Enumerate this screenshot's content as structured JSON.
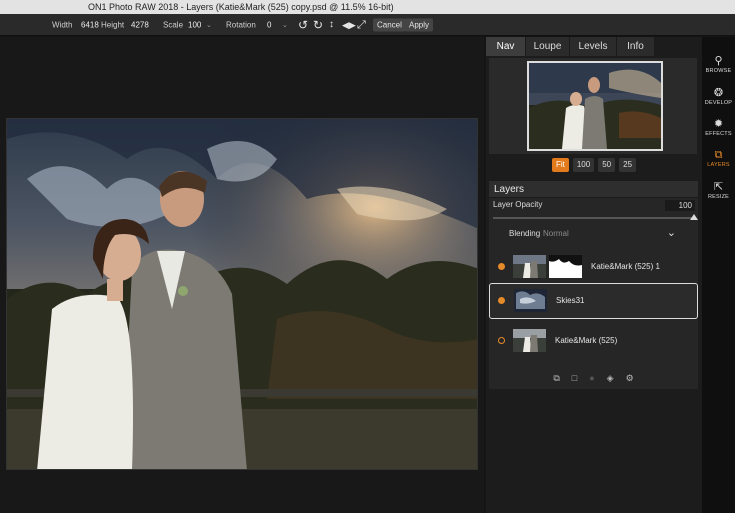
{
  "window": {
    "title": "ON1 Photo RAW 2018 - Layers (Katie&Mark (525) copy.psd @ 11.5% 16-bit)"
  },
  "toolbar": {
    "width_label": "Width",
    "width_value": "6418",
    "height_label": "Height",
    "height_value": "4278",
    "scale_label": "Scale",
    "scale_value": "100",
    "rotation_label": "Rotation",
    "rotation_value": "0",
    "cancel_label": "Cancel",
    "apply_label": "Apply"
  },
  "panel": {
    "tabs": [
      {
        "label": "Nav",
        "active": true
      },
      {
        "label": "Loupe",
        "active": false
      },
      {
        "label": "Levels",
        "active": false
      },
      {
        "label": "Info",
        "active": false
      }
    ],
    "zoom": [
      {
        "label": "Fit",
        "active": true
      },
      {
        "label": "100",
        "active": false
      },
      {
        "label": "50",
        "active": false
      },
      {
        "label": "25",
        "active": false
      }
    ],
    "layers": {
      "title": "Layers",
      "opacity_label": "Layer Opacity",
      "opacity_value": "100",
      "blending_label": "Blending",
      "blending_value": "Normal",
      "items": [
        {
          "name": "Katie&Mark (525) 1",
          "selected": false
        },
        {
          "name": "Skies31",
          "selected": true
        },
        {
          "name": "Katie&Mark (525)",
          "selected": false
        }
      ]
    }
  },
  "modules": [
    {
      "label": "BROWSE",
      "icon": "browse-icon",
      "active": false
    },
    {
      "label": "DEVELOP",
      "icon": "develop-icon",
      "active": false
    },
    {
      "label": "EFFECTS",
      "icon": "effects-icon",
      "active": false
    },
    {
      "label": "LAYERS",
      "icon": "layers-icon",
      "active": true
    },
    {
      "label": "RESIZE",
      "icon": "resize-icon",
      "active": false
    }
  ],
  "colors": {
    "accent": "#e37a1b",
    "panel": "#262626",
    "background": "#141414"
  }
}
